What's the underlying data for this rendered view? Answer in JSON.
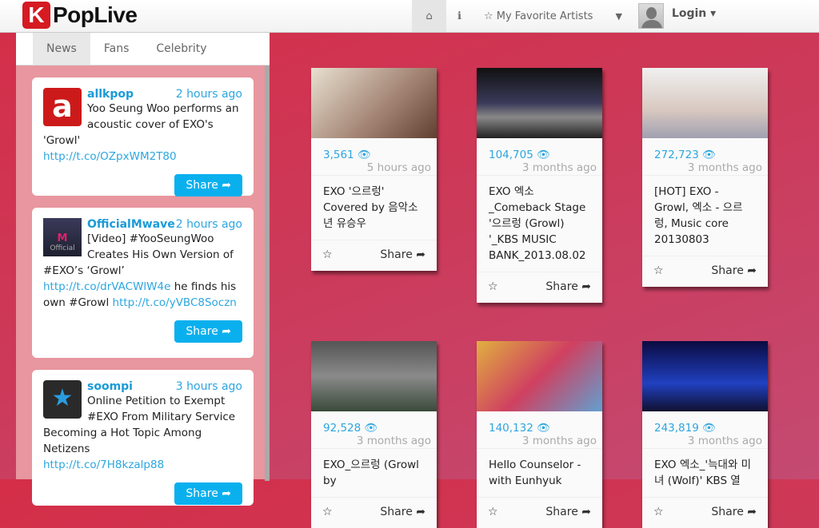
{
  "header": {
    "logo_letter": "K",
    "logo_text": "PopLive",
    "nav": {
      "home": "⌂",
      "info": "ℹ",
      "favorites": "☆ My Favorite Artists",
      "filter": "▼"
    },
    "login": "Login ▾"
  },
  "panel": {
    "tabs": [
      "News",
      "Fans",
      "Celebrity"
    ],
    "tweets": [
      {
        "name": "allkpop",
        "time": "2 hours ago",
        "text": "Yoo Seung Woo performs an acoustic cover of EXO's 'Growl'",
        "link1": "http://t.co/OZpxWM2T80",
        "share": "Share ➦"
      },
      {
        "name": "OfficialMwave",
        "time": "2 hours ago",
        "text": "[Video] #YooSeungWoo Creates His Own Version of #EXO’s ‘Growl’ ",
        "link1": "http://t.co/drVACWlW4e",
        "text2": " he finds his own #Growl ",
        "link2": "http://t.co/yVBC8Soczn",
        "share": "Share ➦"
      },
      {
        "name": "soompi",
        "time": "3 hours ago",
        "text": "Online Petition to Exempt #EXO From Military Service Becoming a Hot Topic Among Netizens",
        "link1": "http://t.co/7H8kzalp88",
        "share": "Share ➦"
      }
    ]
  },
  "videos": [
    {
      "views": "3,561 👁",
      "age": "5 hours ago",
      "title": "EXO '으르렁' Covered by 음악소년 유승우",
      "share": "Share ➦"
    },
    {
      "views": "104,705 👁",
      "age": "3 months ago",
      "title": "EXO 엑소 _Comeback Stage '으르렁 (Growl) '_KBS MUSIC BANK_2013.08.02",
      "share": "Share ➦"
    },
    {
      "views": "272,723 👁",
      "age": "3 months ago",
      "title": "[HOT] EXO - Growl, 엑소 - 으르렁, Music core 20130803",
      "share": "Share ➦"
    },
    {
      "views": "92,528 👁",
      "age": "3 months ago",
      "title": "EXO_으르렁 (Growl by",
      "share": "Share ➦"
    },
    {
      "views": "140,132 👁",
      "age": "3 months ago",
      "title": "Hello Counselor - with Eunhyuk",
      "share": "Share ➦"
    },
    {
      "views": "243,819 👁",
      "age": "3 months ago",
      "title": "EXO 엑소_'늑대와 미녀 (Wolf)' KBS 열",
      "share": "Share ➦"
    }
  ]
}
